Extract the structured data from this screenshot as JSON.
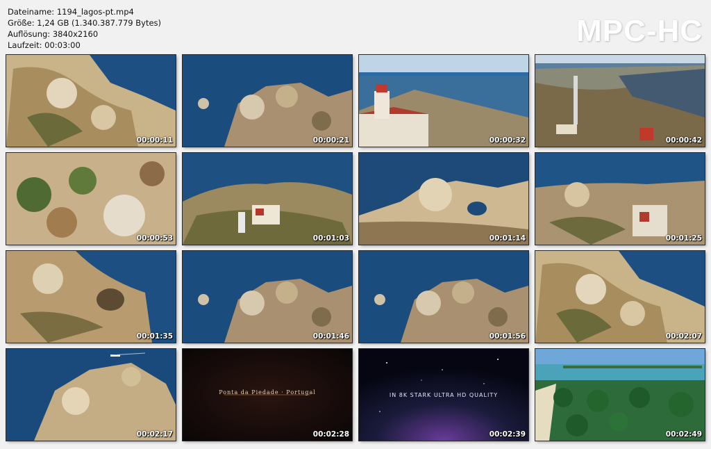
{
  "info": {
    "filename": "Dateiname: 1194_lagos-pt.mp4",
    "size": "Größe: 1,24 GB (1.340.387.779 Bytes)",
    "resolution": "Auflösung: 3840x2160",
    "duration": "Laufzeit: 00:03:00"
  },
  "logo": "MPC-HC",
  "thumbnails": [
    {
      "time": "00:00:11",
      "scene": "rocky-coast"
    },
    {
      "time": "00:00:21",
      "scene": "sea-stacks"
    },
    {
      "time": "00:00:32",
      "scene": "lighthouse-closeup"
    },
    {
      "time": "00:00:42",
      "scene": "cliff-top-lighthouse"
    },
    {
      "time": "00:00:53",
      "scene": "overhead-rocks"
    },
    {
      "time": "00:01:03",
      "scene": "lighthouse-headland"
    },
    {
      "time": "00:01:14",
      "scene": "rock-arch"
    },
    {
      "time": "00:01:25",
      "scene": "lighthouse-overhead"
    },
    {
      "time": "00:01:35",
      "scene": "grotto-cliffs"
    },
    {
      "time": "00:01:46",
      "scene": "sea-stacks"
    },
    {
      "time": "00:01:56",
      "scene": "sea-stacks"
    },
    {
      "time": "00:02:07",
      "scene": "rocky-coast"
    },
    {
      "time": "00:02:17",
      "scene": "headland-boat"
    },
    {
      "time": "00:02:28",
      "scene": "title-card",
      "title": "Ponta da Piedade · Portugal"
    },
    {
      "time": "00:02:39",
      "scene": "space-card",
      "title": "IN 8K STARK ULTRA HD QUALITY"
    },
    {
      "time": "00:02:49",
      "scene": "palm-beach"
    }
  ]
}
